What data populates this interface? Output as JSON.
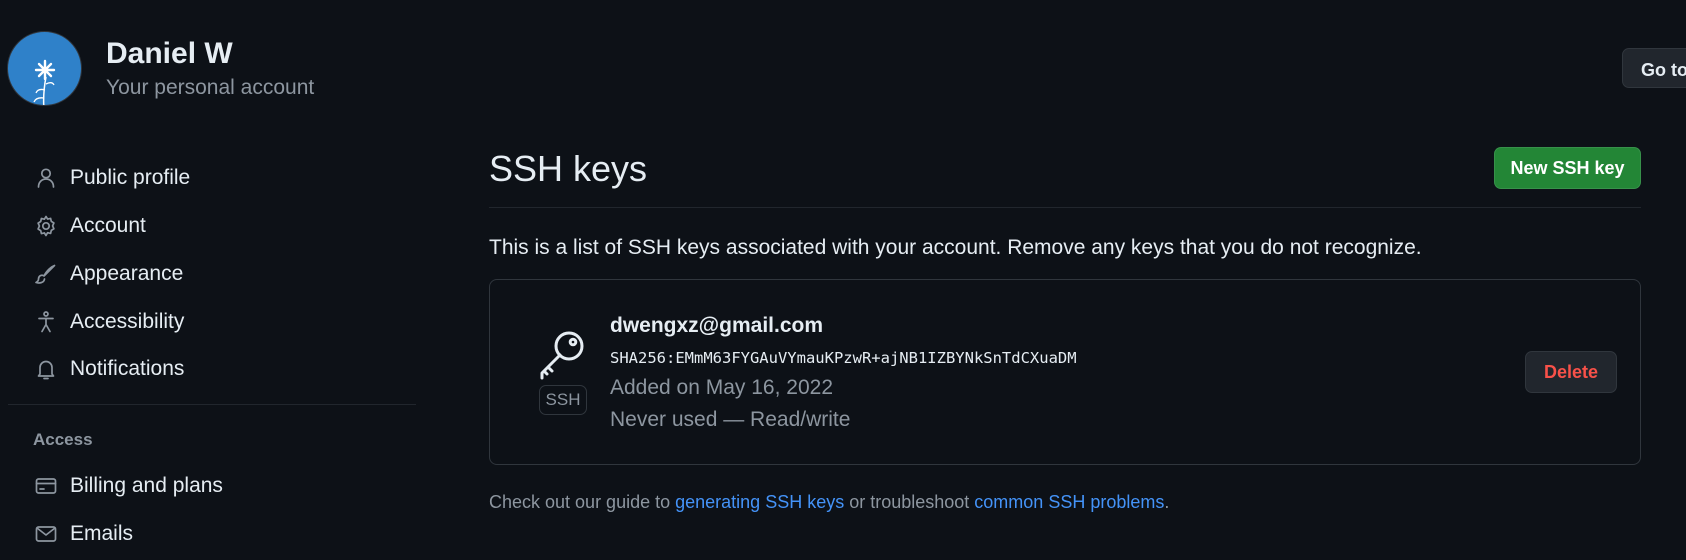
{
  "account": {
    "name": "Daniel W",
    "subtitle": "Your personal account",
    "goto_button": "Go to"
  },
  "sidebar": {
    "items": [
      {
        "label": "Public profile",
        "icon": "person-icon"
      },
      {
        "label": "Account",
        "icon": "gear-icon"
      },
      {
        "label": "Appearance",
        "icon": "paintbrush-icon"
      },
      {
        "label": "Accessibility",
        "icon": "accessibility-icon"
      },
      {
        "label": "Notifications",
        "icon": "bell-icon"
      }
    ],
    "section_access": "Access",
    "access_items": [
      {
        "label": "Billing and plans",
        "icon": "credit-card-icon"
      },
      {
        "label": "Emails",
        "icon": "mail-icon"
      }
    ]
  },
  "main": {
    "title": "SSH keys",
    "new_key_button": "New SSH key",
    "intro": "This is a list of SSH keys associated with your account. Remove any keys that you do not recognize.",
    "keys": [
      {
        "title": "dwengxz@gmail.com",
        "fingerprint": "SHA256:EMmM63FYGAuVYmauKPzwR+ajNB1IZBYNkSnTdCXuaDM",
        "added": "Added on May 16, 2022",
        "usage": "Never used — Read/write",
        "badge": "SSH",
        "delete_label": "Delete"
      }
    ],
    "footer": {
      "prefix": "Check out our guide to ",
      "link1": "generating SSH keys",
      "middle": " or troubleshoot ",
      "link2": "common SSH problems",
      "suffix": "."
    }
  },
  "colors": {
    "background": "#0d1117",
    "primary_button": "#238636",
    "danger_text": "#f85149",
    "link": "#4493f8",
    "muted_text": "#8d96a0"
  }
}
